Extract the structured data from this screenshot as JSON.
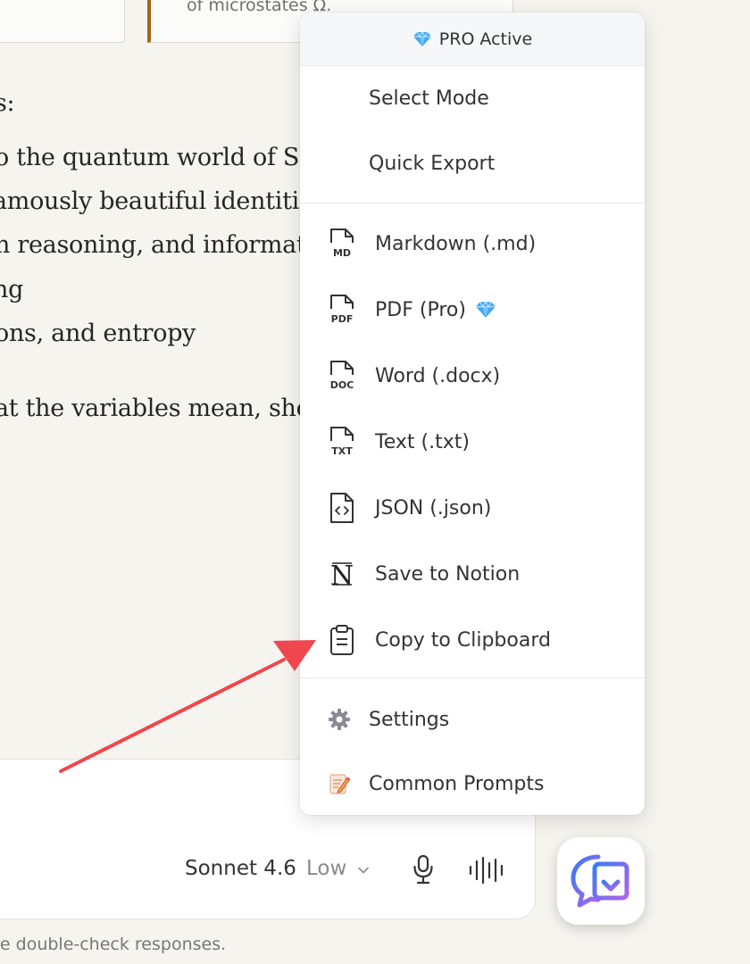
{
  "background": {
    "quote_text": "of microstates Ω.",
    "lines": [
      "s:",
      "o the quantum world of Sc",
      "amously beautiful identitie",
      "n reasoning, and informat",
      "ng",
      "ons, and entropy",
      "at the variables mean, show"
    ],
    "disclaimer": "se double-check responses."
  },
  "composer": {
    "model": "Sonnet 4.6",
    "effort": "Low"
  },
  "menu": {
    "header": "PRO Active",
    "modes": [
      "Select Mode",
      "Quick Export"
    ],
    "exports": [
      {
        "label": "Markdown (.md)",
        "icon": "markdown-file-icon",
        "tag": "MD"
      },
      {
        "label": "PDF (Pro)",
        "icon": "pdf-file-icon",
        "tag": "PDF"
      },
      {
        "label": "Word (.docx)",
        "icon": "word-file-icon",
        "tag": "DOC"
      },
      {
        "label": "Text (.txt)",
        "icon": "text-file-icon",
        "tag": "TXT"
      },
      {
        "label": "JSON (.json)",
        "icon": "json-file-icon",
        "tag": "<>"
      },
      {
        "label": "Save to Notion",
        "icon": "notion-icon",
        "tag": "N"
      },
      {
        "label": "Copy to Clipboard",
        "icon": "clipboard-icon",
        "tag": ""
      }
    ],
    "settings": [
      {
        "label": "Settings",
        "icon": "gear-icon"
      },
      {
        "label": "Common Prompts",
        "icon": "notepad-icon"
      }
    ]
  },
  "colors": {
    "accent_arrow": "#f0474f",
    "quote_border": "#a0661d",
    "pro_gem": "#3fa9f5"
  }
}
